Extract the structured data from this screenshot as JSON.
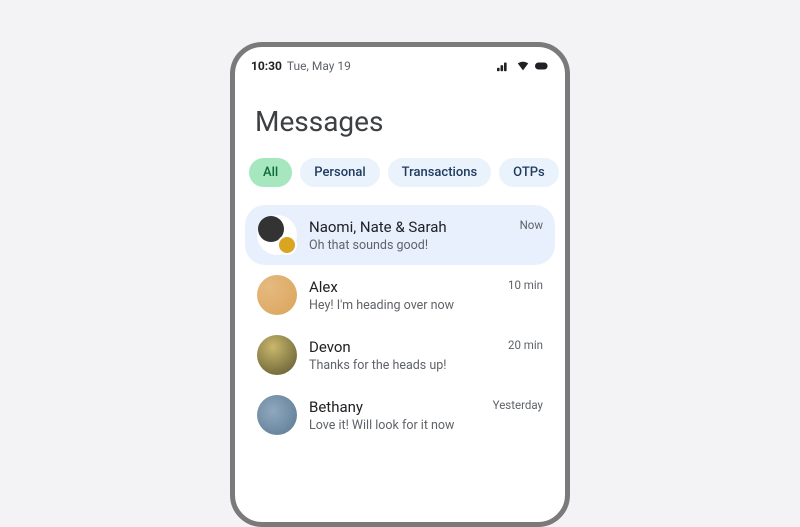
{
  "statusBar": {
    "time": "10:30",
    "date": "Tue, May 19"
  },
  "title": "Messages",
  "tabs": [
    {
      "label": "All",
      "active": true
    },
    {
      "label": "Personal",
      "active": false
    },
    {
      "label": "Transactions",
      "active": false
    },
    {
      "label": "OTPs",
      "active": false
    }
  ],
  "conversations": [
    {
      "name": "Naomi, Nate & Sarah",
      "preview": "Oh that sounds good!",
      "time": "Now",
      "selected": true,
      "avatar": "group"
    },
    {
      "name": "Alex",
      "preview": "Hey! I'm heading over now",
      "time": "10 min",
      "selected": false,
      "avatar": "a1"
    },
    {
      "name": "Devon",
      "preview": "Thanks for the heads up!",
      "time": "20 min",
      "selected": false,
      "avatar": "a2"
    },
    {
      "name": "Bethany",
      "preview": "Love it! Will look for it now",
      "time": "Yesterday",
      "selected": false,
      "avatar": "a3"
    }
  ]
}
